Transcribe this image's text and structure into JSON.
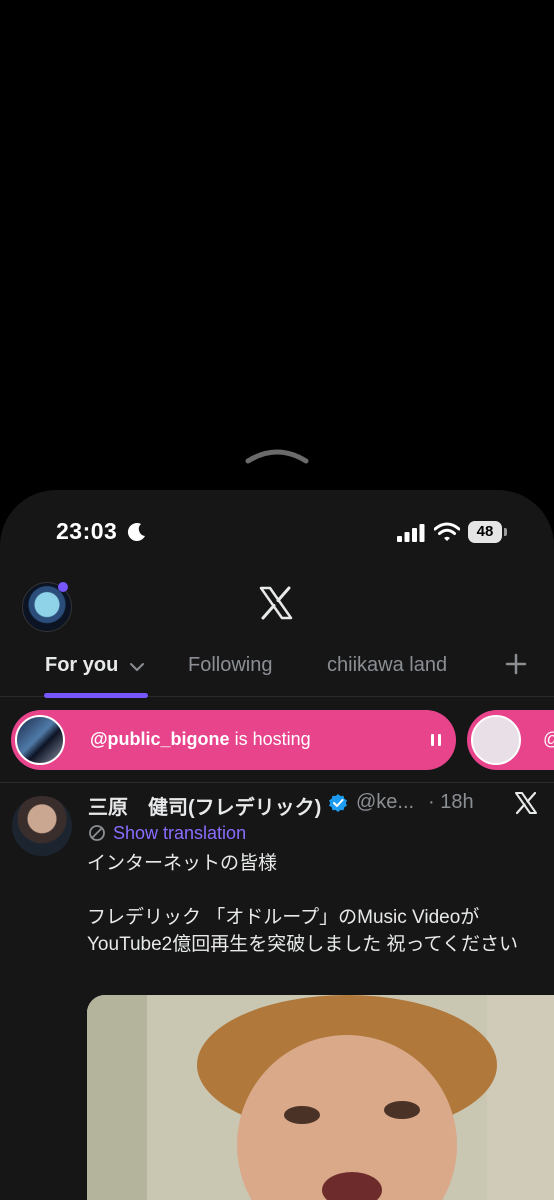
{
  "status_bar": {
    "time": "23:03",
    "battery": "48",
    "icons": [
      "moon-icon",
      "signal-icon",
      "wifi-icon",
      "battery-icon"
    ]
  },
  "header": {
    "logo": "x-logo"
  },
  "tabs": [
    {
      "label": "For you",
      "active": true
    },
    {
      "label": "Following",
      "active": false
    },
    {
      "label": "chiikawa land",
      "active": false
    }
  ],
  "spaces": {
    "host_handle": "@public_bigone",
    "host_suffix": " is hosting",
    "second_prefix": "@"
  },
  "tweet": {
    "author_name": "三原　健司(フレデリック)",
    "handle": "@ke...",
    "time": "· 18h",
    "show_translation": "Show translation",
    "text": "インターネットの皆様\n\nフレデリック 「オドループ」のMusic Videoが YouTube2億回再生を突破しました 祝ってください"
  },
  "colors": {
    "accent": "#7856ff",
    "spaces_pink": "#e8448c",
    "verified": "#1d9bf0"
  }
}
